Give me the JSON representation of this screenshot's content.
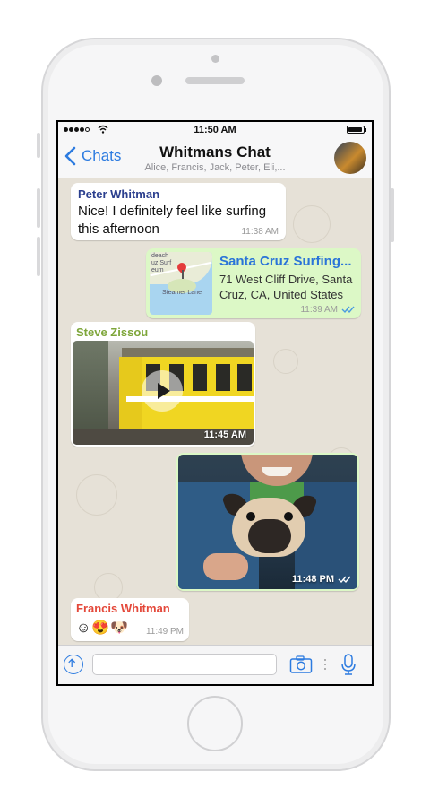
{
  "status_bar": {
    "time": "11:50 AM"
  },
  "nav": {
    "back_label": "Chats",
    "title": "Whitmans Chat",
    "subtitle": "Alice, Francis, Jack, Peter, Eli,..."
  },
  "colors": {
    "accent": "#2c7be0",
    "outgoing_bubble": "#dcf8c6",
    "incoming_bubble": "#ffffff",
    "chat_background": "#e6e1d7",
    "sender_peter": "#2b3f8e",
    "sender_steve": "#7ea63a",
    "sender_francis": "#e4483a",
    "read_ticks": "#4a9be0"
  },
  "messages": [
    {
      "type": "text",
      "direction": "incoming",
      "sender": "Peter Whitman",
      "text_line1": "Nice! I definitely feel like surfing",
      "text_line2": "this afternoon",
      "time": "11:38 AM"
    },
    {
      "type": "location",
      "direction": "outgoing",
      "title": "Santa Cruz Surfing...",
      "address_line1": "71 West Cliff Drive, Santa",
      "address_line2": "Cruz, CA, United States",
      "map_label1": "deach",
      "map_label2": "uz Surf",
      "map_label3": "eum",
      "map_label4": "Steamer Lane",
      "time": "11:39 AM",
      "status": "read"
    },
    {
      "type": "video",
      "direction": "incoming",
      "sender": "Steve Zissou",
      "time": "11:45 AM",
      "play_icon": "play-icon"
    },
    {
      "type": "image",
      "direction": "outgoing",
      "time": "11:48 PM",
      "status": "delivered"
    },
    {
      "type": "emoji",
      "direction": "incoming",
      "sender": "Francis Whitman",
      "emojis": "☺😍🐶",
      "time": "11:49 PM"
    }
  ],
  "input_bar": {
    "placeholder": "",
    "attach_icon": "upload-icon",
    "camera_icon": "camera-icon",
    "mic_icon": "microphone-icon"
  }
}
